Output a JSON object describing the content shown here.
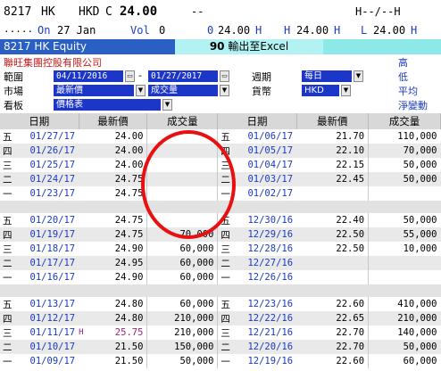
{
  "quote": {
    "code": "8217",
    "market": "HK",
    "currency": "HKD",
    "close_tag": "C",
    "close": "24.00",
    "dashes": "--",
    "hilo_tag": "H--/--H",
    "dots": ".....",
    "on_label": "On",
    "on_date": "27 Jan",
    "vol_label": "Vol",
    "vol": "0",
    "open_tag": "0",
    "open": "24.00",
    "open_suffix": "H",
    "high_tag": "H",
    "high": "24.00",
    "high_suffix": "H",
    "low_tag": "L",
    "low": "24.00",
    "low_suffix": "H"
  },
  "bar": {
    "security": "8217 HK Equity",
    "num": "90",
    "export": "輸出至Excel"
  },
  "form": {
    "company": "聯旺集團控股有限公司",
    "range_label": "範圍",
    "date_from": "04/11/2016",
    "date_to": "01/27/2017",
    "range_dash": "-",
    "period_label": "週期",
    "period": "每日",
    "market_label": "市場",
    "price_type": "最新價",
    "volume_type": "成交量",
    "currency_label": "貨幣",
    "currency": "HKD",
    "view_label": "看板",
    "view": "價格表",
    "stats": [
      "高",
      "低",
      "平均",
      "淨變動"
    ]
  },
  "table": {
    "headers": [
      "日期",
      "最新價",
      "成交量",
      "日期",
      "最新價",
      "成交量"
    ],
    "rows": [
      {
        "d1": "五",
        "t1": "01/27/17",
        "f1": "",
        "p1": "24.00",
        "v1": "",
        "d2": "五",
        "t2": "01/06/17",
        "p2": "21.70",
        "v2": "110,000"
      },
      {
        "d1": "四",
        "t1": "01/26/17",
        "f1": "",
        "p1": "24.00",
        "v1": "",
        "d2": "四",
        "t2": "01/05/17",
        "p2": "22.10",
        "v2": "70,000"
      },
      {
        "d1": "三",
        "t1": "01/25/17",
        "f1": "",
        "p1": "24.00",
        "v1": "",
        "d2": "三",
        "t2": "01/04/17",
        "p2": "22.15",
        "v2": "50,000"
      },
      {
        "d1": "二",
        "t1": "01/24/17",
        "f1": "",
        "p1": "24.75",
        "v1": "",
        "d2": "二",
        "t2": "01/03/17",
        "p2": "22.45",
        "v2": "50,000"
      },
      {
        "d1": "一",
        "t1": "01/23/17",
        "f1": "",
        "p1": "24.75",
        "v1": "",
        "d2": "一",
        "t2": "01/02/17",
        "p2": "",
        "v2": ""
      },
      {
        "sep": true
      },
      {
        "d1": "五",
        "t1": "01/20/17",
        "f1": "",
        "p1": "24.75",
        "v1": "",
        "d2": "五",
        "t2": "12/30/16",
        "p2": "22.40",
        "v2": "50,000"
      },
      {
        "d1": "四",
        "t1": "01/19/17",
        "f1": "",
        "p1": "24.75",
        "v1": "70,000",
        "d2": "四",
        "t2": "12/29/16",
        "p2": "22.50",
        "v2": "55,000"
      },
      {
        "d1": "三",
        "t1": "01/18/17",
        "f1": "",
        "p1": "24.90",
        "v1": "60,000",
        "d2": "三",
        "t2": "12/28/16",
        "p2": "22.50",
        "v2": "10,000"
      },
      {
        "d1": "二",
        "t1": "01/17/17",
        "f1": "",
        "p1": "24.95",
        "v1": "60,000",
        "d2": "二",
        "t2": "12/27/16",
        "p2": "",
        "v2": ""
      },
      {
        "d1": "一",
        "t1": "01/16/17",
        "f1": "",
        "p1": "24.90",
        "v1": "60,000",
        "d2": "一",
        "t2": "12/26/16",
        "p2": "",
        "v2": ""
      },
      {
        "sep": true
      },
      {
        "d1": "五",
        "t1": "01/13/17",
        "f1": "",
        "p1": "24.80",
        "v1": "60,000",
        "d2": "五",
        "t2": "12/23/16",
        "p2": "22.60",
        "v2": "410,000"
      },
      {
        "d1": "四",
        "t1": "01/12/17",
        "f1": "",
        "p1": "24.80",
        "v1": "210,000",
        "d2": "四",
        "t2": "12/22/16",
        "p2": "22.65",
        "v2": "210,000"
      },
      {
        "d1": "三",
        "t1": "01/11/17",
        "f1": "H",
        "p1": "25.75",
        "v1": "210,000",
        "d2": "三",
        "t2": "12/21/16",
        "p2": "22.70",
        "v2": "140,000"
      },
      {
        "d1": "二",
        "t1": "01/10/17",
        "f1": "",
        "p1": "21.50",
        "v1": "150,000",
        "d2": "二",
        "t2": "12/20/16",
        "p2": "22.70",
        "v2": "50,000"
      },
      {
        "d1": "一",
        "t1": "01/09/17",
        "f1": "",
        "p1": "21.50",
        "v1": "50,000",
        "d2": "一",
        "t2": "12/19/16",
        "p2": "22.60",
        "v2": "60,000"
      }
    ]
  },
  "colors": {
    "bar_left": "#2a5fc4",
    "bar_bg": "#8fe8e8",
    "dropdown": "#1c36c8",
    "annotation": "#e81010",
    "date_text": "#1a3bbf"
  }
}
